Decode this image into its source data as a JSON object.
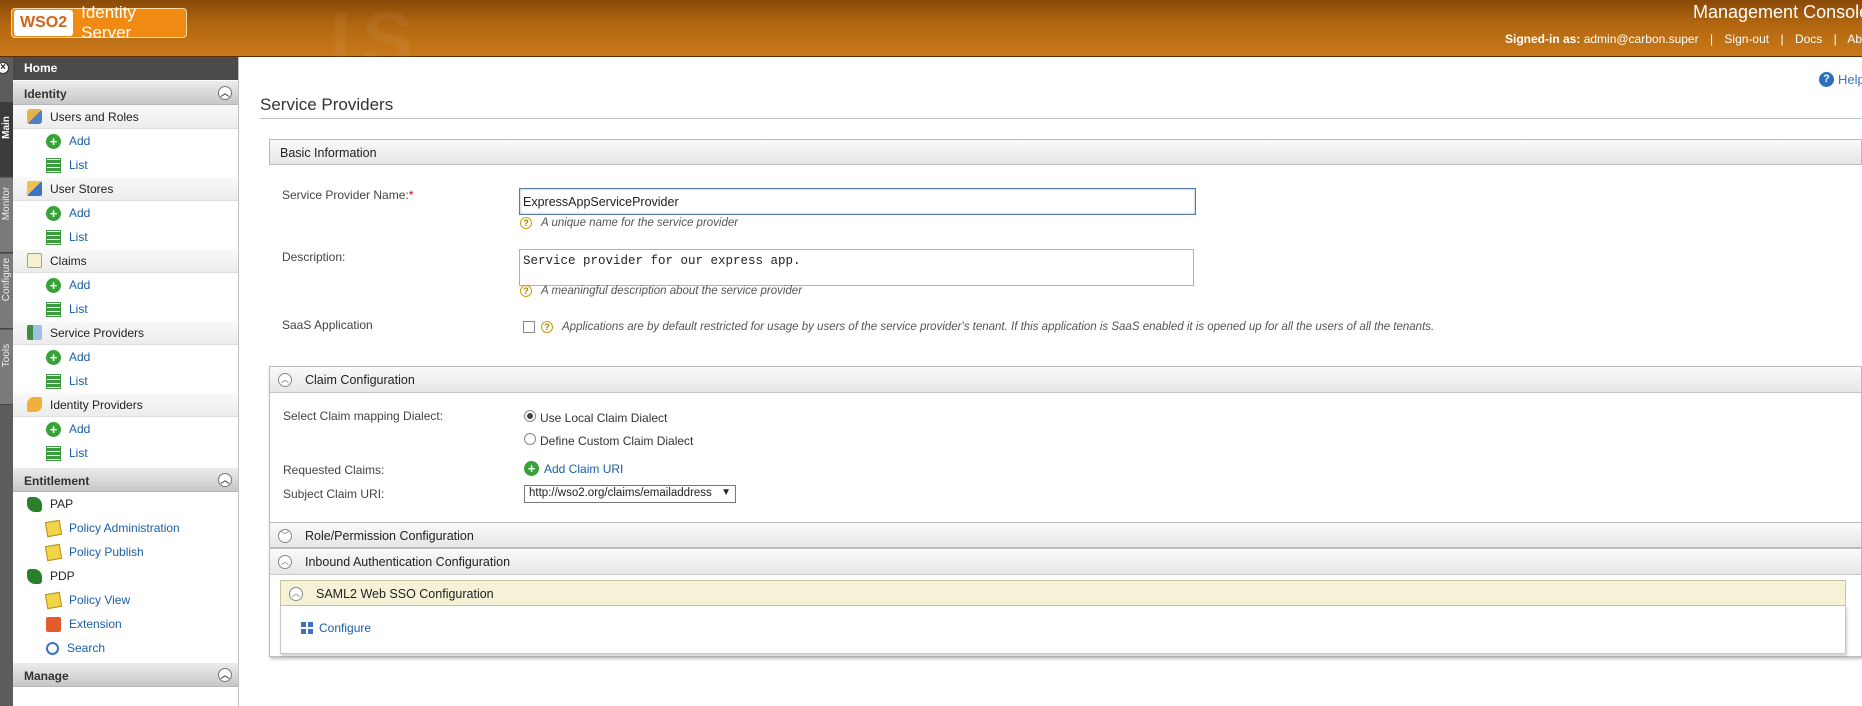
{
  "header": {
    "logo_brand": "WSO2",
    "logo_product": "Identity Server",
    "console_title": "Management Console",
    "signed_in_label": "Signed-in as:",
    "signed_in_user": "admin@carbon.super",
    "sign_out": "Sign-out",
    "docs": "Docs",
    "about": "About"
  },
  "vtabs": [
    "Main",
    "Monitor",
    "Configure",
    "Tools"
  ],
  "sidebar": {
    "home": "Home",
    "identity": {
      "title": "Identity",
      "groups": [
        {
          "label": "Users and Roles",
          "icon": "users-roles-icon",
          "add": "Add",
          "list": "List"
        },
        {
          "label": "User Stores",
          "icon": "user-stores-icon",
          "add": "Add",
          "list": "List"
        },
        {
          "label": "Claims",
          "icon": "claims-icon",
          "add": "Add",
          "list": "List"
        },
        {
          "label": "Service Providers",
          "icon": "service-providers-icon",
          "add": "Add",
          "list": "List"
        },
        {
          "label": "Identity Providers",
          "icon": "identity-providers-icon",
          "add": "Add",
          "list": "List"
        }
      ]
    },
    "entitlement": {
      "title": "Entitlement",
      "pap": "PAP",
      "policy_administration": "Policy Administration",
      "policy_publish": "Policy Publish",
      "pdp": "PDP",
      "policy_view": "Policy View",
      "extension": "Extension",
      "search": "Search"
    },
    "manage": {
      "title": "Manage"
    }
  },
  "main": {
    "help": "Help",
    "page_title": "Service Providers",
    "basic_info": {
      "title": "Basic Information",
      "sp_name_label": "Service Provider Name:",
      "required_mark": "*",
      "sp_name_value": "ExpressAppServiceProvider",
      "sp_name_hint": "A unique name for the service provider",
      "description_label": "Description:",
      "description_value": "Service provider for our express app.",
      "description_hint": "A meaningful description about the service provider",
      "saas_label": "SaaS Application",
      "saas_hint": "Applications are by default restricted for usage by users of the service provider's tenant. If this application is SaaS enabled it is opened up for all the users of all the tenants."
    },
    "claim_config": {
      "title": "Claim Configuration",
      "dialect_label": "Select Claim mapping Dialect:",
      "use_local": "Use Local Claim Dialect",
      "define_custom": "Define Custom Claim Dialect",
      "requested_claims_label": "Requested Claims:",
      "add_claim_uri": "Add Claim URI",
      "subject_claim_label": "Subject Claim URI:",
      "subject_claim_value": "http://wso2.org/claims/emailaddress"
    },
    "role_permission": {
      "title": "Role/Permission Configuration"
    },
    "inbound_auth": {
      "title": "Inbound Authentication Configuration",
      "saml_title": "SAML2 Web SSO Configuration",
      "configure": "Configure"
    }
  }
}
